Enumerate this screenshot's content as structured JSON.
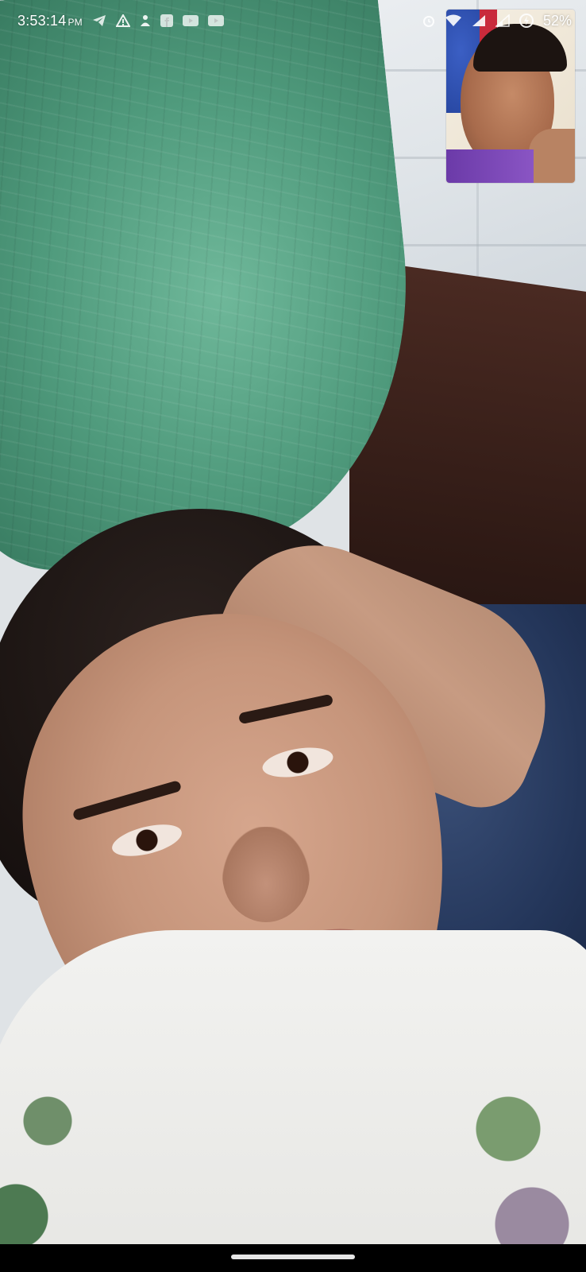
{
  "status_bar": {
    "time": "3:53:14",
    "ampm": "PM",
    "left_icons": [
      "telegram-icon",
      "warning-icon",
      "person-icon",
      "facebook-icon",
      "youtube-icon",
      "youtube-icon"
    ],
    "right_icons": [
      "alarm-icon",
      "wifi-icon",
      "signal-icon",
      "signal-icon",
      "battery-saver-icon"
    ],
    "battery": "52%"
  },
  "call": {
    "remote_video": "remote-participant-feed",
    "self_preview": "self-camera-preview"
  },
  "colors": {
    "status_text": "#ffffff",
    "nav_bar": "#000000",
    "home_indicator": "#e6e6e6"
  }
}
